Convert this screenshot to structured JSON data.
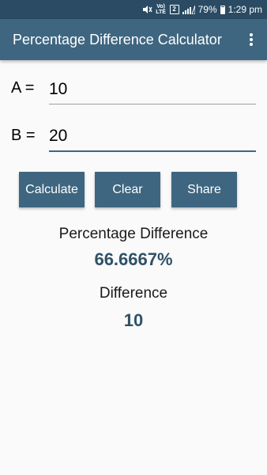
{
  "status_bar": {
    "network_badge": "2",
    "lte_label": "Vo) LTE",
    "battery_percent": "79%",
    "time": "1:29 pm",
    "icons": [
      "mute-icon",
      "wifi-calling-icon",
      "signal-icon",
      "battery-icon"
    ]
  },
  "app_bar": {
    "title": "Percentage Difference Calculator",
    "overflow_icon": "more-vert-icon"
  },
  "form": {
    "a_label": "A =",
    "a_value": "10",
    "b_label": "B =",
    "b_value": "20"
  },
  "buttons": {
    "calculate": "Calculate",
    "clear": "Clear",
    "share": "Share"
  },
  "results": {
    "percentage_label": "Percentage Difference",
    "percentage_value": "66.6667%",
    "difference_label": "Difference",
    "difference_value": "10"
  },
  "colors": {
    "status_bar": "#2a4b63",
    "app_bar": "#3f6680",
    "button": "#3f6680",
    "result_value": "#2f5167",
    "background": "#fafafa"
  }
}
